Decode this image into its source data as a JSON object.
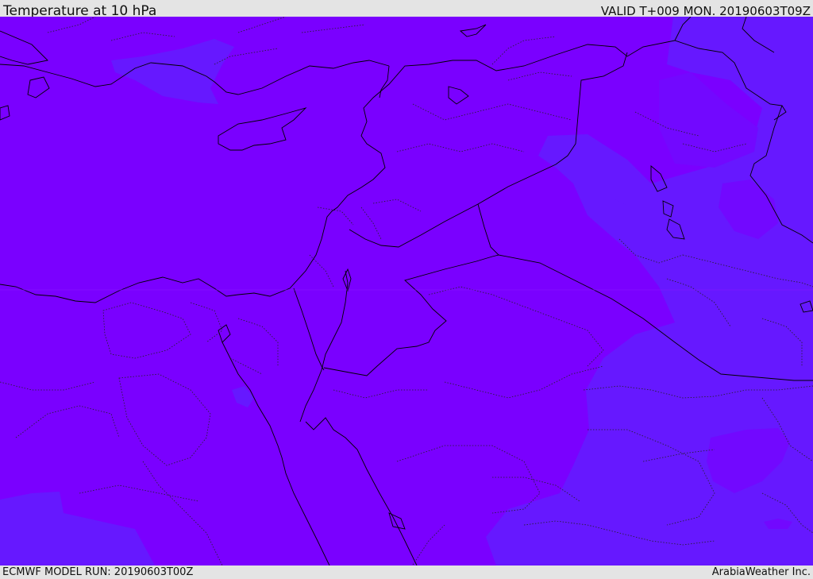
{
  "header": {
    "title": "Temperature at 10 hPa",
    "valid": "VALID T+009 MON. 20190603T09Z"
  },
  "footer": {
    "run": "ECMWF MODEL RUN: 20190603T00Z",
    "credit": "ArabiaWeather Inc."
  },
  "colors": {
    "field_main": "#7a00ff",
    "field_cooler": "#6618ff",
    "coast": "#000000",
    "borders": "#222222"
  }
}
